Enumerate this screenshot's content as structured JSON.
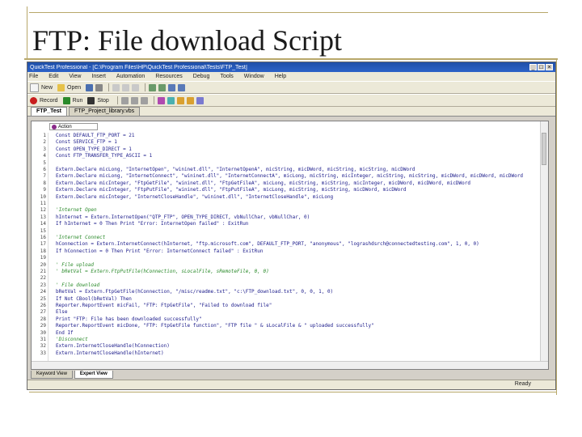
{
  "slide": {
    "title": "FTP: File download Script"
  },
  "window": {
    "title": "QuickTest Professional - [C:\\Program Files\\HP\\QuickTest Professional\\Tests\\FTP_Test]",
    "controls": [
      "_",
      "□",
      "×"
    ]
  },
  "menu": [
    "File",
    "Edit",
    "View",
    "Insert",
    "Automation",
    "Resources",
    "Debug",
    "Tools",
    "Window",
    "Help"
  ],
  "toolbar": {
    "row1": {
      "new_label": "New",
      "open_label": "Open"
    },
    "row2": {
      "record_label": "Record",
      "run_label": "Run",
      "stop_label": "Stop"
    }
  },
  "tabs": [
    "FTP_Test",
    "FTP_Project_library.vbs"
  ],
  "editor": {
    "combo_label": "Action"
  },
  "code_lines": [
    {
      "n": "1",
      "text": "Const DEFAULT_FTP_PORT = 21",
      "style": "code"
    },
    {
      "n": "2",
      "text": "Const SERVICE_FTP = 1",
      "style": "code"
    },
    {
      "n": "3",
      "text": "Const OPEN_TYPE_DIRECT = 1",
      "style": "code"
    },
    {
      "n": "4",
      "text": "Const FTP_TRANSFER_TYPE_ASCII = 1",
      "style": "code"
    },
    {
      "n": "5",
      "text": "",
      "style": "code"
    },
    {
      "n": "6",
      "text": "Extern.Declare micLong, \"InternetOpen\", \"wininet.dll\", \"InternetOpenA\", micString, micDWord, micString, micString, micDWord",
      "style": "code"
    },
    {
      "n": "7",
      "text": "Extern.Declare micLong, \"InternetConnect\", \"wininet.dll\", \"InternetConnectA\", micLong, micString, micInteger, micString, micString, micDWord, micDWord, micDWord",
      "style": "code"
    },
    {
      "n": "8",
      "text": "Extern.Declare micInteger, \"FtpGetFile\", \"wininet.dll\", \"FtpGetFileA\", micLong, micString, micString, micInteger, micDWord, micDWord, micDWord",
      "style": "code"
    },
    {
      "n": "9",
      "text": "Extern.Declare micInteger, \"FtpPutFile\", \"wininet.dll\", \"FtpPutFileA\", micLong, micString, micString, micDWord, micDWord",
      "style": "code"
    },
    {
      "n": "10",
      "text": "Extern.Declare micInteger, \"InternetCloseHandle\", \"wininet.dll\", \"InternetCloseHandle\", micLong",
      "style": "code"
    },
    {
      "n": "11",
      "text": "",
      "style": "code"
    },
    {
      "n": "12",
      "text": "'Internet Open",
      "style": "cmt"
    },
    {
      "n": "13",
      "text": "hInternet = Extern.InternetOpen(\"QTP_FTP\", OPEN_TYPE_DIRECT, vbNullChar, vbNullChar, 0)",
      "style": "code"
    },
    {
      "n": "14",
      "text": "If hInternet = 0 Then Print \"Error: InternetOpen failed\" : ExitRun",
      "style": "code"
    },
    {
      "n": "15",
      "text": "",
      "style": "code"
    },
    {
      "n": "16",
      "text": "'Internet Connect",
      "style": "cmt"
    },
    {
      "n": "17",
      "text": "hConnection = Extern.InternetConnect(hInternet, \"ftp.microsoft.com\", DEFAULT_FTP_PORT, \"anonymous\", \"lograshdsrch@connectedtesting.com\", 1, 0, 0)",
      "style": "code"
    },
    {
      "n": "18",
      "text": "If hConnection = 0 Then Print \"Error: InternetConnect failed\" : ExitRun",
      "style": "code"
    },
    {
      "n": "19",
      "text": "",
      "style": "code"
    },
    {
      "n": "20",
      "text": "' File upload",
      "style": "cmt"
    },
    {
      "n": "21",
      "text": "' bRetVal = Extern.FtpPutFile(hConnection, sLocalFile, sRemoteFile, 0, 0)",
      "style": "cmt"
    },
    {
      "n": "22",
      "text": "",
      "style": "code"
    },
    {
      "n": "23",
      "text": "' File download",
      "style": "cmt"
    },
    {
      "n": "24",
      "text": "bRetVal = Extern.FtpGetFile(hConnection, \"/misc/readme.txt\", \"c:\\FTP_download.txt\", 0, 0, 1, 0)",
      "style": "code"
    },
    {
      "n": "25",
      "text": "If Not CBool(bRetVal) Then",
      "style": "code"
    },
    {
      "n": "26",
      "text": "  Reporter.ReportEvent micFail, \"FTP: FtpGetFile\", \"Failed to download file\"",
      "style": "code"
    },
    {
      "n": "27",
      "text": "Else",
      "style": "code"
    },
    {
      "n": "28",
      "text": "  Print \"FTP: File has been downloaded successfully\"",
      "style": "code"
    },
    {
      "n": "29",
      "text": "  Reporter.ReportEvent micDone, \"FTP: FtpGetFile function\", \"FTP file \" & sLocalFile & \" uploaded successfully\"",
      "style": "code"
    },
    {
      "n": "30",
      "text": "End If",
      "style": "code"
    },
    {
      "n": "31",
      "text": "'Disconnect",
      "style": "cmt"
    },
    {
      "n": "32",
      "text": "Extern.InternetCloseHandle(hConnection)",
      "style": "code"
    },
    {
      "n": "33",
      "text": "Extern.InternetCloseHandle(hInternet)",
      "style": "code"
    }
  ],
  "view_tabs": [
    "Keyword View",
    "Expert View"
  ],
  "status": {
    "text": "Ready"
  },
  "colors": {
    "title_bar": "#1f4fa8",
    "code_text": "#1a1a8a",
    "comment_text": "#2a8a2a",
    "slide_accent": "#b8a86a"
  }
}
